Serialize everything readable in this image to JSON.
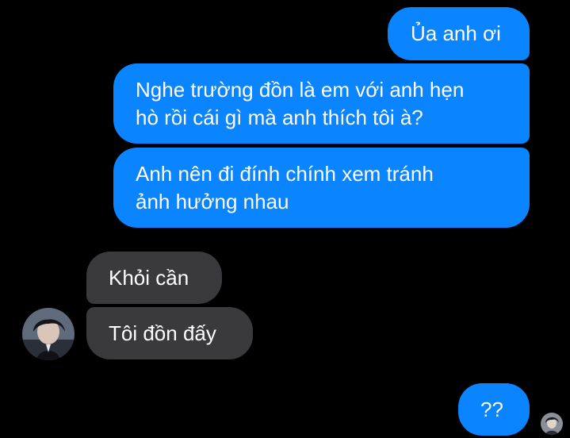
{
  "conversation": {
    "messages": [
      {
        "sender": "me",
        "text": "Ủa anh ơi"
      },
      {
        "sender": "me",
        "text": "Nghe trường đồn là em với anh hẹn\nhò rồi cái gì mà anh thích tôi à?"
      },
      {
        "sender": "me",
        "text": "Anh nên đi đính chính xem tránh\nảnh hưởng nhau"
      },
      {
        "sender": "other",
        "text": "Khỏi cần"
      },
      {
        "sender": "other",
        "text": "Tôi đồn đấy"
      },
      {
        "sender": "me",
        "text": "??"
      }
    ]
  },
  "colors": {
    "background": "#000000",
    "outgoing_bubble": "#0a84ff",
    "incoming_bubble": "#3a3a3c",
    "text": "#ffffff"
  },
  "icons": {
    "contact_avatar": "contact-avatar-icon",
    "seen_receipt": "seen-avatar-icon"
  }
}
